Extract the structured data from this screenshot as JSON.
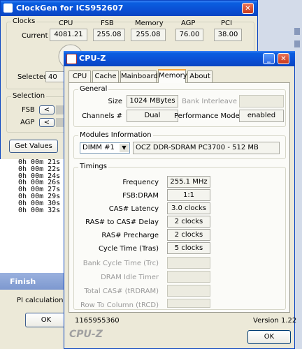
{
  "clockgen": {
    "title": "ClockGen for ICS952607",
    "clocks_legend": "Clocks",
    "columns": [
      "CPU",
      "FSB",
      "Memory",
      "AGP",
      "PCI"
    ],
    "current_label": "Current",
    "current_values": [
      "4081.21",
      "255.08",
      "255.08",
      "76.00",
      "38.00"
    ],
    "selected_label": "Selected",
    "selected_value": "40",
    "selection_legend": "Selection",
    "fsb_label": "FSB",
    "agp_label": "AGP",
    "arrow_left": "<",
    "get_values_label": "Get Values"
  },
  "console_lines": [
    "0h 00m 21s",
    "0h 00m 22s",
    "0h 00m 24s",
    "0h 00m 26s",
    "0h 00m 27s",
    "0h 00m 29s",
    "0h 00m 30s",
    "0h 00m 32s"
  ],
  "finish": {
    "title": "Finish",
    "message": "PI calculation is c",
    "ok_label": "OK"
  },
  "cpuz": {
    "title": "CPU-Z",
    "tabs": [
      "CPU",
      "Cache",
      "Mainboard",
      "Memory",
      "About"
    ],
    "active_tab": "Memory",
    "general": {
      "legend": "General",
      "size_label": "Size",
      "size_value": "1024 MBytes",
      "bank_label": "Bank Interleave",
      "channels_label": "Channels #",
      "channels_value": "Dual",
      "perf_label": "Performance Mode",
      "perf_value": "enabled"
    },
    "modules": {
      "legend": "Modules Information",
      "selected_dimm": "DIMM #1",
      "module_desc": "OCZ DDR-SDRAM PC3700 - 512 MB"
    },
    "timings": {
      "legend": "Timings",
      "rows": [
        {
          "label": "Frequency",
          "value": "255.1 MHz"
        },
        {
          "label": "FSB:DRAM",
          "value": "1:1"
        },
        {
          "label": "CAS# Latency",
          "value": "3.0 clocks"
        },
        {
          "label": "RAS# to CAS# Delay",
          "value": "2 clocks"
        },
        {
          "label": "RAS# Precharge",
          "value": "2 clocks"
        },
        {
          "label": "Cycle Time (Tras)",
          "value": "5 clocks"
        },
        {
          "label": "Bank Cycle Time (Trc)",
          "value": ""
        },
        {
          "label": "DRAM Idle Timer",
          "value": ""
        },
        {
          "label": "Total CAS# (tRDRAM)",
          "value": ""
        },
        {
          "label": "Row To Column (tRCD)",
          "value": ""
        }
      ]
    },
    "status_id": "1165955360",
    "version": "Version 1.22",
    "brand": "CPU-Z",
    "ok_label": "OK"
  },
  "colors": {
    "titlebar": "#0a4fd4",
    "dialog_bg": "#ece9d8",
    "active_tab_accent": "#f2a43a"
  }
}
